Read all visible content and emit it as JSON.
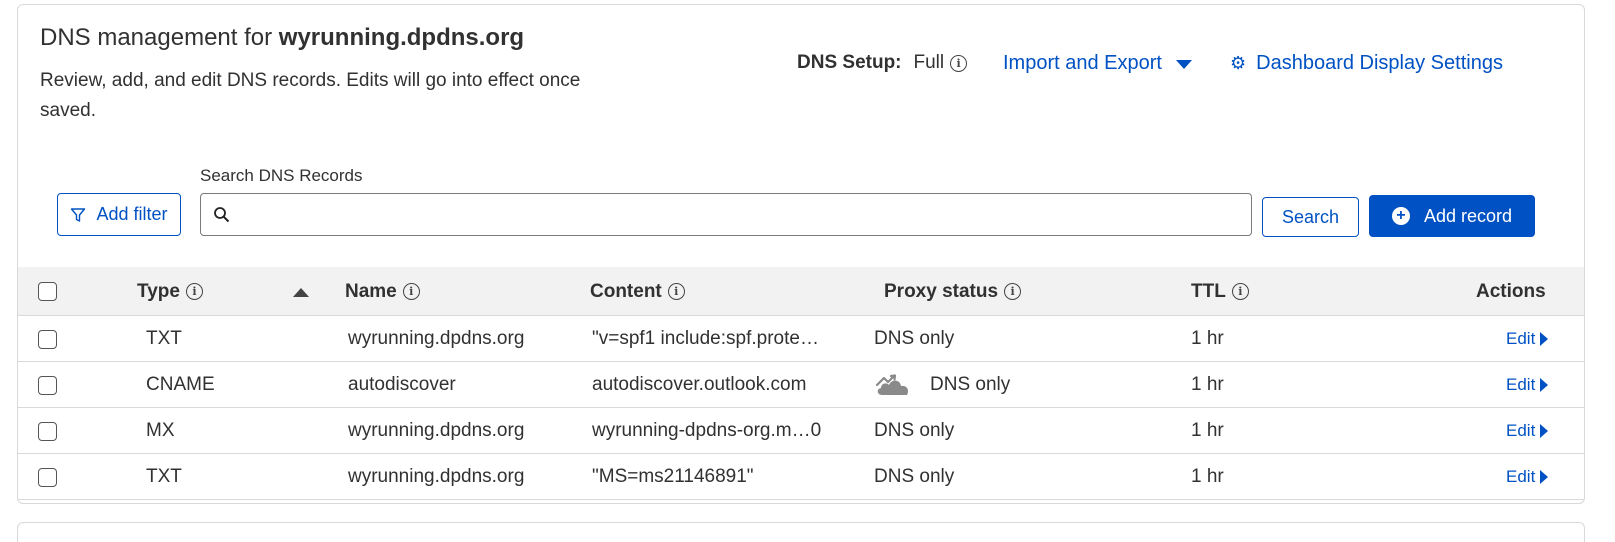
{
  "header": {
    "title_prefix": "DNS management for",
    "domain": "wyrunning.dpdns.org",
    "subtitle": "Review, add, and edit DNS records. Edits will go into effect once saved.",
    "dns_setup_label": "DNS Setup:",
    "dns_setup_value": "Full",
    "import_export": "Import and Export",
    "dashboard_settings": "Dashboard Display Settings"
  },
  "search": {
    "label": "Search DNS Records",
    "value": "",
    "add_filter": "Add filter",
    "search_button": "Search",
    "add_record": "Add record"
  },
  "table": {
    "columns": {
      "type": "Type",
      "name": "Name",
      "content": "Content",
      "proxy": "Proxy status",
      "ttl": "TTL",
      "actions": "Actions"
    },
    "sort": {
      "column": "Type",
      "direction": "ascending"
    },
    "rows": [
      {
        "type": "TXT",
        "name": "wyrunning.dpdns.org",
        "content": "\"v=spf1 include:spf.prote…",
        "proxy": "DNS only",
        "proxy_icon": "",
        "ttl": "1 hr",
        "action": "Edit"
      },
      {
        "type": "CNAME",
        "name": "autodiscover",
        "content": "autodiscover.outlook.com",
        "proxy": "DNS only",
        "proxy_icon": "cloud-dns-only-icon",
        "ttl": "1 hr",
        "action": "Edit"
      },
      {
        "type": "MX",
        "name": "wyrunning.dpdns.org",
        "content": "wyrunning-dpdns-org.m…0",
        "proxy": "DNS only",
        "proxy_icon": "",
        "ttl": "1 hr",
        "action": "Edit"
      },
      {
        "type": "TXT",
        "name": "wyrunning.dpdns.org",
        "content": "\"MS=ms21146891\"",
        "proxy": "DNS only",
        "proxy_icon": "",
        "ttl": "1 hr",
        "action": "Edit"
      }
    ]
  },
  "colors": {
    "accent": "#0051c3",
    "header_bg": "#f2f2f2",
    "border": "#d9d9d9",
    "text": "#313131"
  }
}
